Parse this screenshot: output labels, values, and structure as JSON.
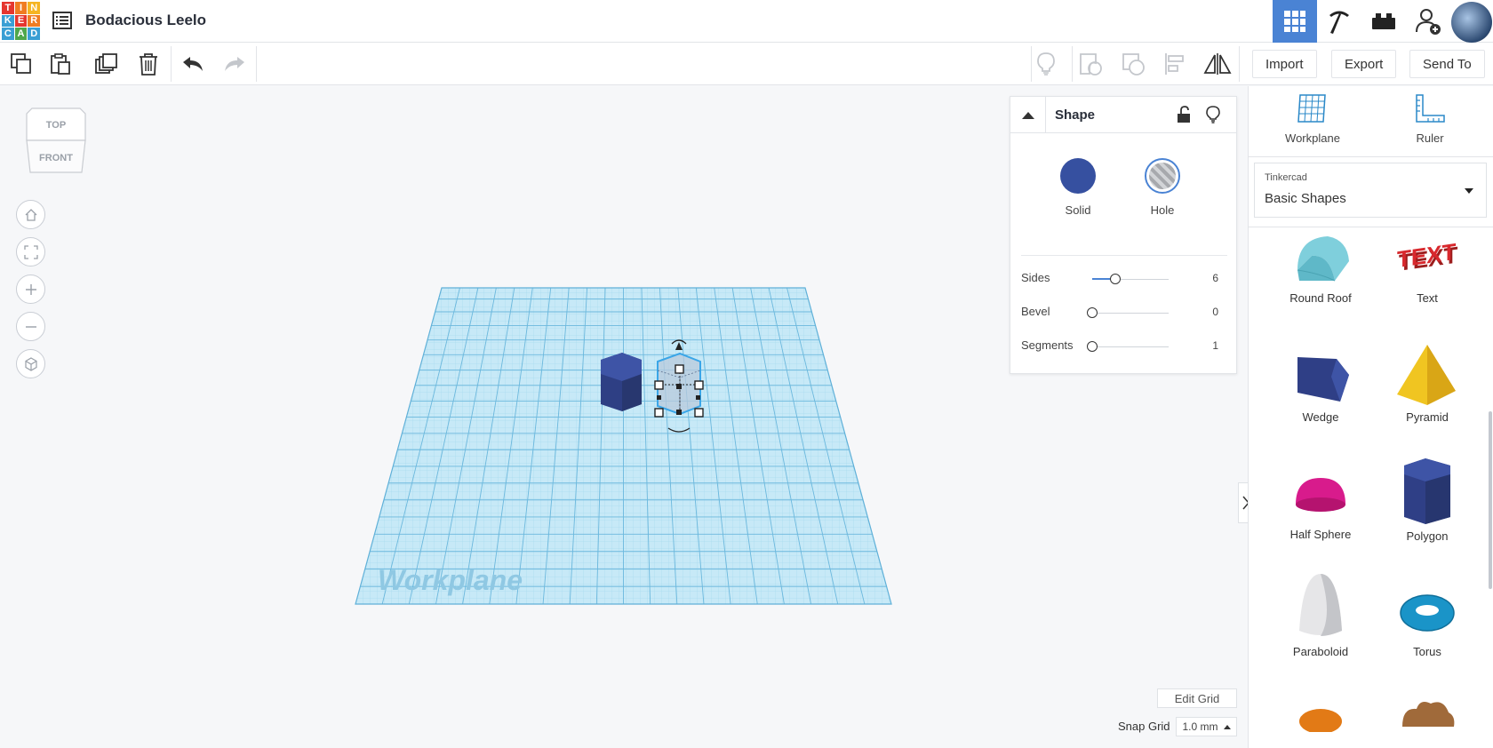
{
  "header": {
    "logo_letters": [
      "T",
      "I",
      "N",
      "K",
      "E",
      "R",
      "C",
      "A",
      "D"
    ],
    "logo_colors": [
      "#e5362f",
      "#f07c22",
      "#f5b523",
      "#3a9fd4",
      "#e5362f",
      "#f07c22",
      "#3a9fd4",
      "#4fa74b",
      "#3a9fd4"
    ],
    "doc_title": "Bodacious Leelo",
    "icons": [
      "grid-icon",
      "pickaxe-icon",
      "brick-icon",
      "add-user-icon",
      "avatar"
    ]
  },
  "toolbar": {
    "left_tools": [
      "copy-icon",
      "paste-icon",
      "duplicate-icon",
      "trash-icon",
      "undo-icon",
      "redo-icon"
    ],
    "right_tools": [
      "light-bulb-icon",
      "group-icon",
      "ungroup-icon",
      "align-icon",
      "mirror-icon"
    ],
    "import_label": "Import",
    "export_label": "Export",
    "sendto_label": "Send To"
  },
  "viewcube": {
    "top": "TOP",
    "front": "FRONT"
  },
  "workplane": {
    "label": "Workplane"
  },
  "inspector": {
    "title": "Shape",
    "solid_label": "Solid",
    "hole_label": "Hole",
    "solid_color": "#3650a0",
    "props": [
      {
        "label": "Sides",
        "value": "6",
        "fraction": 0.3
      },
      {
        "label": "Bevel",
        "value": "0",
        "fraction": 0.0
      },
      {
        "label": "Segments",
        "value": "1",
        "fraction": 0.0
      }
    ]
  },
  "grid_controls": {
    "edit_grid": "Edit Grid",
    "snap_label": "Snap Grid",
    "snap_value": "1.0 mm"
  },
  "right_panel": {
    "workplane_label": "Workplane",
    "ruler_label": "Ruler",
    "library_small": "Tinkercad",
    "library_main": "Basic Shapes",
    "shapes": [
      {
        "name": "Round Roof"
      },
      {
        "name": "Text"
      },
      {
        "name": "Wedge"
      },
      {
        "name": "Pyramid"
      },
      {
        "name": "Half Sphere"
      },
      {
        "name": "Polygon"
      },
      {
        "name": "Paraboloid"
      },
      {
        "name": "Torus"
      }
    ]
  }
}
